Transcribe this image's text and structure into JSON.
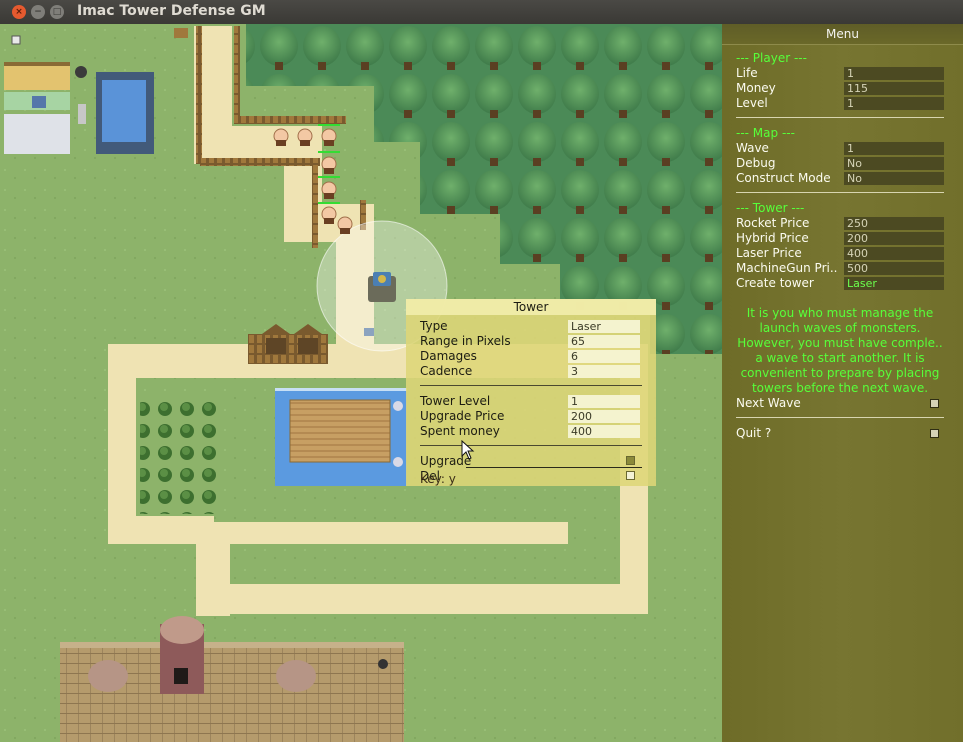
{
  "window": {
    "title": "Imac Tower Defense GM"
  },
  "menu": {
    "title": "Menu",
    "player": {
      "header": "--- Player ---",
      "life_label": "Life",
      "life_value": "1",
      "money_label": "Money",
      "money_value": "115",
      "level_label": "Level",
      "level_value": "1"
    },
    "map": {
      "header": "--- Map ---",
      "wave_label": "Wave",
      "wave_value": "1",
      "debug_label": "Debug",
      "debug_value": "No",
      "construct_label": "Construct Mode",
      "construct_value": "No"
    },
    "tower": {
      "header": "--- Tower ---",
      "rocket_label": "Rocket Price",
      "rocket_value": "250",
      "hybrid_label": "Hybrid Price",
      "hybrid_value": "200",
      "laser_label": "Laser Price",
      "laser_value": "400",
      "machinegun_label": "MachineGun Pri..",
      "machinegun_value": "500",
      "create_label": "Create tower",
      "create_value": "Laser"
    },
    "description": [
      "It is you who must manage the",
      "launch waves of monsters.",
      "However, you must have comple..",
      "a wave to start another. It is",
      "convenient to prepare by placing",
      "towers before the next wave."
    ],
    "next_wave_label": "Next Wave",
    "quit_label": "Quit ?"
  },
  "tower_popup": {
    "title": "Tower",
    "type_label": "Type",
    "type_value": "Laser",
    "range_label": "Range in Pixels",
    "range_value": "65",
    "damages_label": "Damages",
    "damages_value": "6",
    "cadence_label": "Cadence",
    "cadence_value": "3",
    "level_label": "Tower Level",
    "level_value": "1",
    "upgrade_price_label": "Upgrade Price",
    "upgrade_price_value": "200",
    "spent_label": "Spent money",
    "spent_value": "400",
    "upgrade_label": "Upgrade",
    "del_label": "Del",
    "key_text": "Key: y"
  },
  "colors": {
    "menu_bg": "#777531",
    "section_green": "#57ff3a",
    "grass": "#8fb46a",
    "path": "#efe2b0",
    "water": "#5b9ae0"
  },
  "icons": [
    "close-icon",
    "minimize-icon",
    "maximize-icon",
    "mouse-cursor-icon"
  ]
}
